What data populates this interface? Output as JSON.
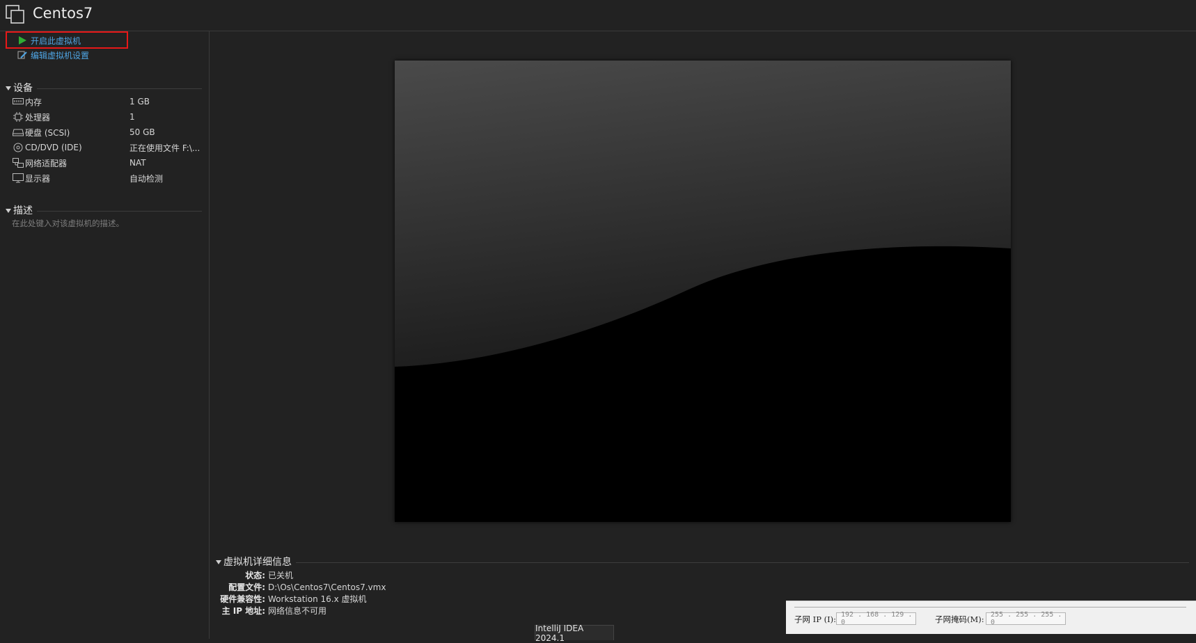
{
  "window": {
    "title": "Centos7"
  },
  "actions": {
    "power_on": "开启此虚拟机",
    "edit_settings": "编辑虚拟机设置"
  },
  "devices": {
    "section_title": "设备",
    "items": [
      {
        "icon": "memory-icon",
        "name": "内存",
        "value": "1 GB"
      },
      {
        "icon": "processor-icon",
        "name": "处理器",
        "value": "1"
      },
      {
        "icon": "hard-disk-icon",
        "name": "硬盘 (SCSI)",
        "value": "50 GB"
      },
      {
        "icon": "cd-dvd-icon",
        "name": "CD/DVD (IDE)",
        "value": "正在使用文件 F:\\..."
      },
      {
        "icon": "network-adapter-icon",
        "name": "网络适配器",
        "value": "NAT"
      },
      {
        "icon": "display-icon",
        "name": "显示器",
        "value": "自动检测"
      }
    ]
  },
  "description": {
    "section_title": "描述",
    "placeholder": "在此处键入对该虚拟机的描述。"
  },
  "details": {
    "section_title": "虚拟机详细信息",
    "rows": [
      {
        "label": "状态:",
        "value": "已关机"
      },
      {
        "label": "配置文件:",
        "value": "D:\\Os\\Centos7\\Centos7.vmx"
      },
      {
        "label": "硬件兼容性:",
        "value": "Workstation 16.x 虚拟机"
      },
      {
        "label": "主 IP 地址:",
        "value": "网络信息不可用"
      }
    ]
  },
  "network_settings": {
    "subnet_ip_label": "子网 IP (I):",
    "subnet_ip_value": "192 . 168 . 129 .  0",
    "subnet_mask_label": "子网掩码(M):",
    "subnet_mask_value": "255 . 255 . 255 .  0"
  },
  "taskbar_tooltip": "IntelliJ IDEA 2024.1",
  "colors": {
    "background": "#222222",
    "link": "#4fa5e4",
    "highlight_border": "#e81818",
    "play_green": "#2fae33"
  }
}
